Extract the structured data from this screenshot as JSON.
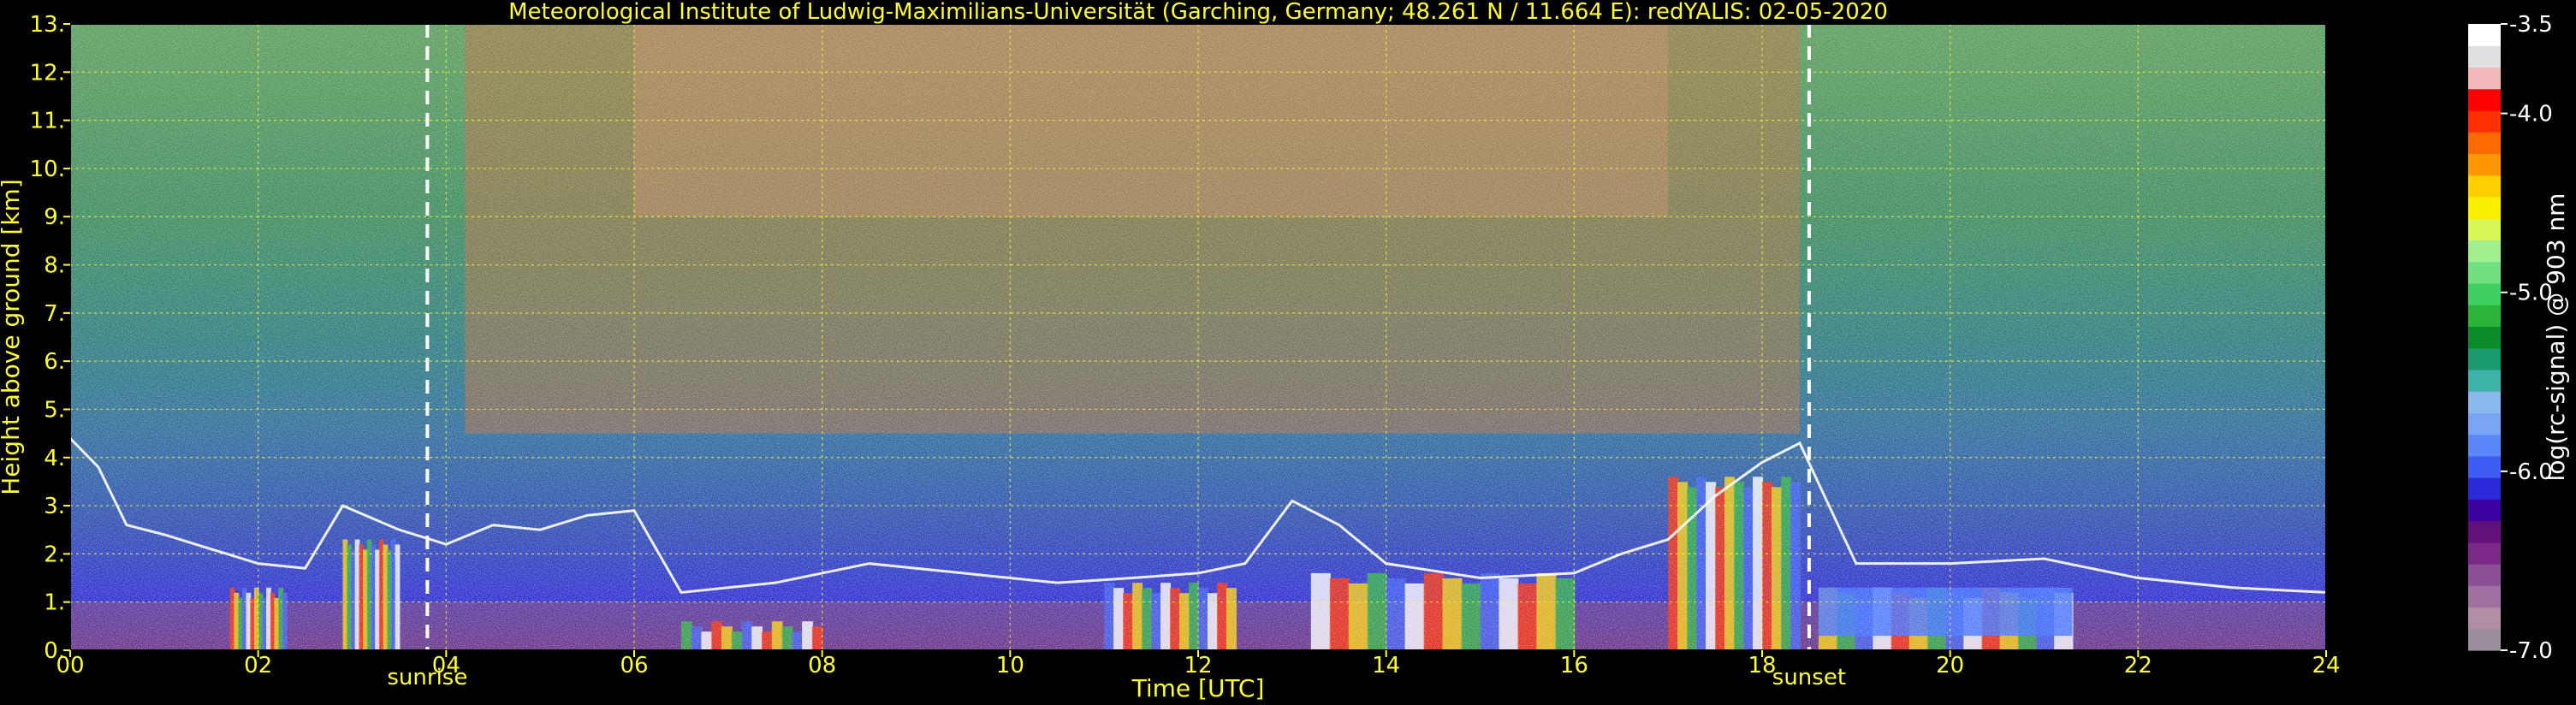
{
  "chart_data": {
    "type": "heatmap",
    "title": "Meteorological Institute of Ludwig-Maximilians-Universität (Garching, Germany; 48.261 N / 11.664 E):    redYALIS: 02-05-2020",
    "xlabel": "Time [UTC]",
    "ylabel": "Height above ground [km]",
    "xlim": [
      0,
      24
    ],
    "ylim": [
      0,
      13
    ],
    "x_ticks": [
      0,
      2,
      4,
      6,
      8,
      10,
      12,
      14,
      16,
      18,
      20,
      22,
      24
    ],
    "x_tick_labels": [
      "00",
      "02",
      "04",
      "06",
      "08",
      "10",
      "12",
      "14",
      "16",
      "18",
      "20",
      "22",
      "24"
    ],
    "y_ticks": [
      0,
      1,
      2,
      3,
      4,
      5,
      6,
      7,
      8,
      9,
      10,
      11,
      12,
      13
    ],
    "y_tick_labels": [
      "0.",
      "1.",
      "2.",
      "3.",
      "4.",
      "5.",
      "6.",
      "7.",
      "8.",
      "9.",
      "10.",
      "11.",
      "12.",
      "13."
    ],
    "grid": true,
    "colorbar": {
      "label": "log(rc-signal) @ 903 nm",
      "range": [
        -7.0,
        -3.5
      ],
      "ticks": [
        -7.0,
        -6.0,
        -5.0,
        -4.0,
        -3.5
      ],
      "tick_labels": [
        "-7.0",
        "-6.0",
        "-5.0",
        "-4.0",
        "-3.5"
      ],
      "colors": [
        "#9a8f9a",
        "#b08fa4",
        "#a070a0",
        "#8c4e94",
        "#7a2a86",
        "#62107a",
        "#3a00a0",
        "#2a2ad8",
        "#3c5cf2",
        "#5a88f8",
        "#7aa4f4",
        "#8ab8ec",
        "#3cb4a8",
        "#1a9870",
        "#0a8a28",
        "#2ab43a",
        "#40d060",
        "#70e080",
        "#a0f090",
        "#d8f858",
        "#f8f000",
        "#ffd000",
        "#ff9800",
        "#ff6a00",
        "#ff3000",
        "#ff0000",
        "#f4b8b8",
        "#e0e0e0",
        "#ffffff"
      ]
    },
    "annotations": [
      {
        "x": 3.8,
        "text": "sunrise"
      },
      {
        "x": 18.5,
        "text": "sunset"
      }
    ],
    "features": {
      "boundary_layer_top_km": [
        {
          "x": 0.0,
          "y": 4.4
        },
        {
          "x": 0.3,
          "y": 3.8
        },
        {
          "x": 0.6,
          "y": 2.6
        },
        {
          "x": 1.0,
          "y": 2.4
        },
        {
          "x": 1.5,
          "y": 2.1
        },
        {
          "x": 2.0,
          "y": 1.8
        },
        {
          "x": 2.5,
          "y": 1.7
        },
        {
          "x": 2.9,
          "y": 3.0
        },
        {
          "x": 3.5,
          "y": 2.5
        },
        {
          "x": 4.0,
          "y": 2.2
        },
        {
          "x": 4.5,
          "y": 2.6
        },
        {
          "x": 5.0,
          "y": 2.5
        },
        {
          "x": 5.5,
          "y": 2.8
        },
        {
          "x": 6.0,
          "y": 2.9
        },
        {
          "x": 6.5,
          "y": 1.2
        },
        {
          "x": 7.5,
          "y": 1.4
        },
        {
          "x": 8.5,
          "y": 1.8
        },
        {
          "x": 9.5,
          "y": 1.6
        },
        {
          "x": 10.5,
          "y": 1.4
        },
        {
          "x": 11.3,
          "y": 1.5
        },
        {
          "x": 12.0,
          "y": 1.6
        },
        {
          "x": 12.5,
          "y": 1.8
        },
        {
          "x": 13.0,
          "y": 3.1
        },
        {
          "x": 13.5,
          "y": 2.6
        },
        {
          "x": 14.0,
          "y": 1.8
        },
        {
          "x": 15.0,
          "y": 1.5
        },
        {
          "x": 16.0,
          "y": 1.6
        },
        {
          "x": 16.5,
          "y": 2.0
        },
        {
          "x": 17.0,
          "y": 2.3
        },
        {
          "x": 17.5,
          "y": 3.2
        },
        {
          "x": 18.0,
          "y": 3.9
        },
        {
          "x": 18.4,
          "y": 4.3
        },
        {
          "x": 19.0,
          "y": 1.8
        },
        {
          "x": 20.0,
          "y": 1.8
        },
        {
          "x": 21.0,
          "y": 1.9
        },
        {
          "x": 22.0,
          "y": 1.5
        },
        {
          "x": 23.0,
          "y": 1.3
        },
        {
          "x": 24.0,
          "y": 1.2
        }
      ],
      "dense_aerosol_regions": [
        {
          "x0": 1.7,
          "x1": 2.3,
          "top": 1.3
        },
        {
          "x0": 2.9,
          "x1": 3.5,
          "top": 2.3
        },
        {
          "x0": 6.5,
          "x1": 8.0,
          "top": 0.6
        },
        {
          "x0": 11.0,
          "x1": 12.4,
          "top": 1.4
        },
        {
          "x0": 13.2,
          "x1": 16.0,
          "top": 1.6
        },
        {
          "x0": 17.0,
          "x1": 18.4,
          "top": 3.6
        },
        {
          "x0": 18.6,
          "x1": 21.3,
          "top": 1.3
        }
      ]
    }
  }
}
